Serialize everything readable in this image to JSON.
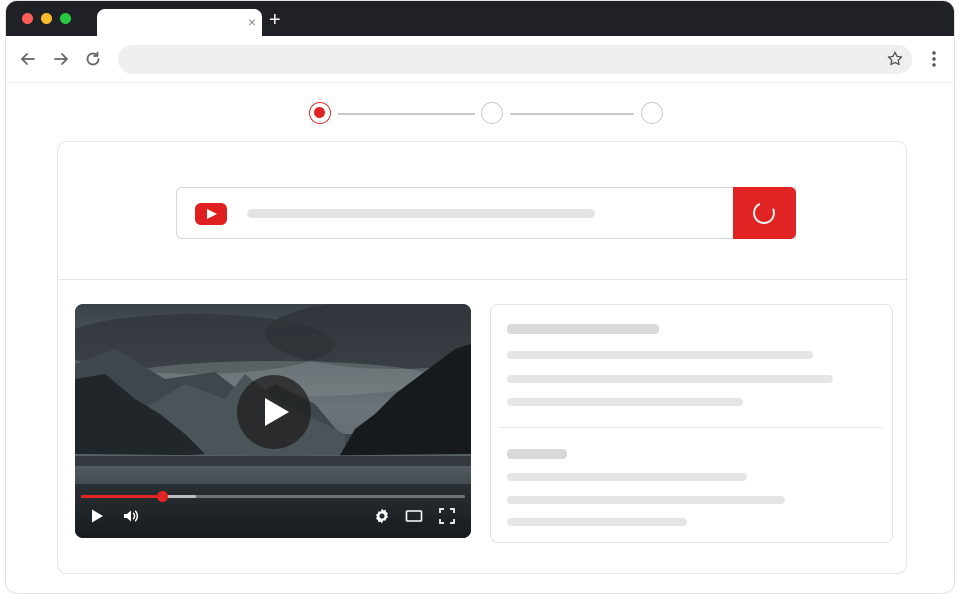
{
  "browser": {
    "tab_title": "",
    "tab_close": "×",
    "new_tab": "+",
    "address": "",
    "icons": [
      "back-icon",
      "forward-icon",
      "reload-icon",
      "star-icon",
      "menu-icon"
    ]
  },
  "stepper": {
    "steps": 3,
    "current_step": 1,
    "accent_color": "#e02424"
  },
  "search": {
    "url_value": "",
    "logo": "youtube-logo-icon",
    "submit_state": "loading",
    "accent_color": "#e02424"
  },
  "player": {
    "progress_fraction": 0.21,
    "buffer_fraction": 0.3,
    "controls": [
      "play-icon",
      "volume-icon",
      "settings-icon",
      "theater-icon",
      "fullscreen-icon"
    ]
  },
  "details": {
    "loading": true
  }
}
